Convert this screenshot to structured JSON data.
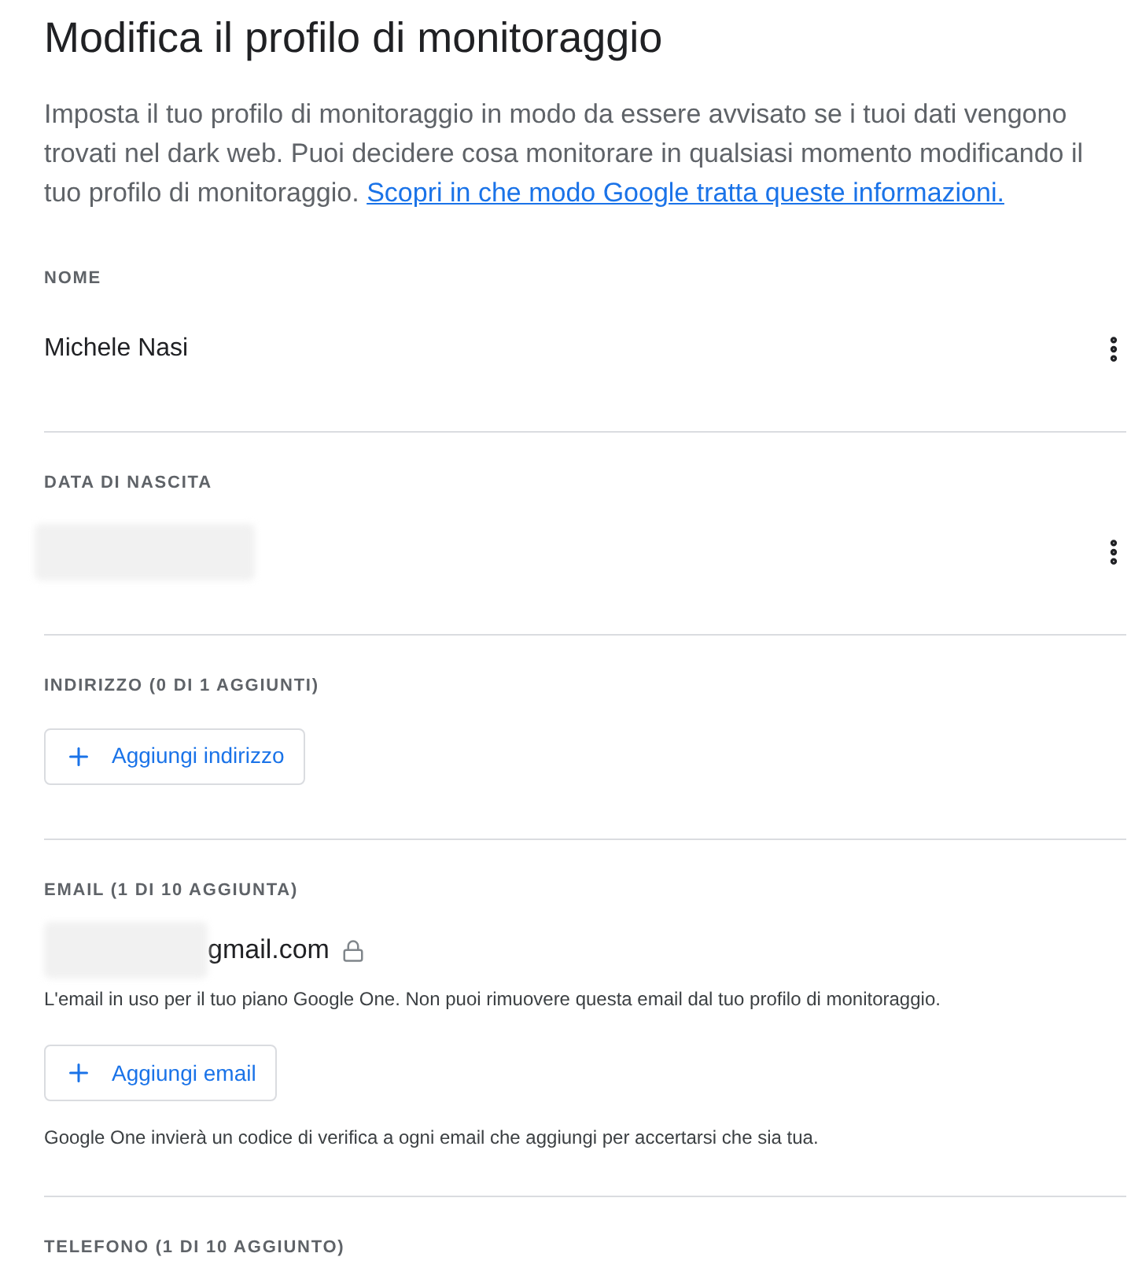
{
  "title": "Modifica il profilo di monitoraggio",
  "intro": {
    "text": "Imposta il tuo profilo di monitoraggio in modo da essere avvisato se i tuoi dati vengono trovati nel dark web. Puoi decidere cosa monitorare in qualsiasi momento modificando il tuo profilo di monitoraggio.",
    "link": "Scopri in che modo Google tratta queste informazioni."
  },
  "sections": [
    {
      "kind": "value",
      "heading": "NOME",
      "value": "Michele Nasi",
      "redacted": false
    },
    {
      "kind": "value",
      "heading": "DATA DI NASCITA",
      "redacted": true
    },
    {
      "kind": "add",
      "heading": "INDIRIZZO (0 DI 1 AGGIUNTI)",
      "button": "Aggiungi indirizzo"
    },
    {
      "kind": "email",
      "heading": "EMAIL (1 DI 10 AGGIUNTA)",
      "value": "gmail.com",
      "locked": true,
      "note": "L'email in uso per il tuo piano Google One. Non puoi rimuovere questa email dal tuo profilo di monitoraggio.",
      "button": "Aggiungi email",
      "hint": "Google One invierà un codice di verifica a ogni email che aggiungi per accertarsi che sia tua."
    },
    {
      "kind": "heading",
      "heading": "TELEFONO (1 DI 10 AGGIUNTO)"
    }
  ]
}
